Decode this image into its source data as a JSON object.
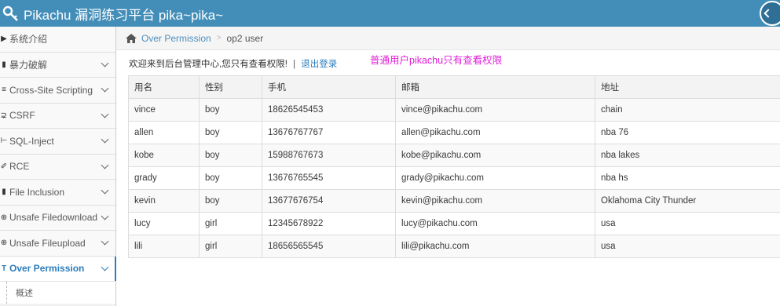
{
  "header": {
    "title": "Pikachu 漏洞练习平台 pika~pika~"
  },
  "sidebar": {
    "items": [
      {
        "label": "系统介绍",
        "icon": "▶",
        "chevron": false
      },
      {
        "label": "暴力破解",
        "icon": "▮",
        "chevron": true
      },
      {
        "label": "Cross-Site Scripting",
        "icon": "≡",
        "chevron": true
      },
      {
        "label": "CSRF",
        "icon": "⊋",
        "chevron": true
      },
      {
        "label": "SQL-Inject",
        "icon": "⊢",
        "chevron": true
      },
      {
        "label": "RCE",
        "icon": "✐",
        "chevron": true
      },
      {
        "label": "File Inclusion",
        "icon": "▮",
        "chevron": true
      },
      {
        "label": "Unsafe Filedownload",
        "icon": "⊕",
        "chevron": true
      },
      {
        "label": "Unsafe Fileupload",
        "icon": "⊕",
        "chevron": true
      },
      {
        "label": "Over Permission",
        "icon": "T",
        "chevron": true,
        "active": true
      }
    ],
    "sub_items": [
      {
        "label": "概述"
      }
    ]
  },
  "breadcrumb": {
    "link": "Over Permission",
    "current": "op2 user"
  },
  "welcome": {
    "text": "欢迎来到后台管理中心,您只有查看权限!",
    "separator": "|",
    "logout": "退出登录"
  },
  "notice": "普通用户pikachu只有查看权限",
  "table": {
    "headers": [
      "用名",
      "性别",
      "手机",
      "邮箱",
      "地址"
    ],
    "rows": [
      [
        "vince",
        "boy",
        "18626545453",
        "vince@pikachu.com",
        "chain"
      ],
      [
        "allen",
        "boy",
        "13676767767",
        "allen@pikachu.com",
        "nba 76"
      ],
      [
        "kobe",
        "boy",
        "15988767673",
        "kobe@pikachu.com",
        "nba lakes"
      ],
      [
        "grady",
        "boy",
        "13676765545",
        "grady@pikachu.com",
        "nba hs"
      ],
      [
        "kevin",
        "boy",
        "13677676754",
        "kevin@pikachu.com",
        "Oklahoma City Thunder"
      ],
      [
        "lucy",
        "girl",
        "12345678922",
        "lucy@pikachu.com",
        "usa"
      ],
      [
        "lili",
        "girl",
        "18656565545",
        "lili@pikachu.com",
        "usa"
      ]
    ]
  },
  "colors": {
    "topbar": "#438eb9",
    "accent": "#2b7dbc",
    "notice": "#e21dd8"
  }
}
